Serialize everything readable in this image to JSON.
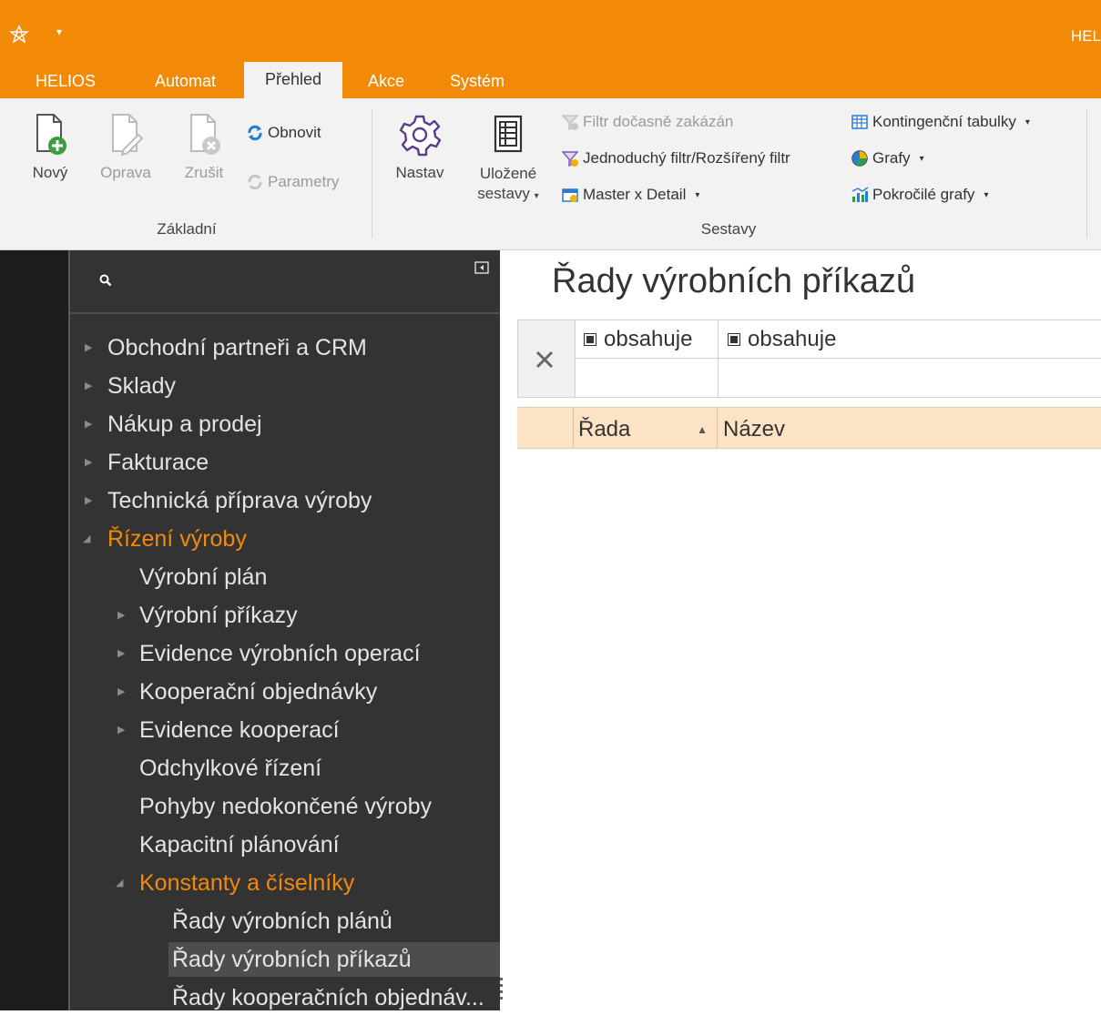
{
  "titlebar": {
    "app_title": "HEL",
    "logo_icon": "helios-logo-icon",
    "quick_access_icon": "dropdown-arrow-icon"
  },
  "tabs": [
    {
      "label": "HELIOS"
    },
    {
      "label": "Automat"
    },
    {
      "label": "Přehled",
      "active": true
    },
    {
      "label": "Akce"
    },
    {
      "label": "Systém"
    }
  ],
  "ribbon": {
    "groups": {
      "zakladni": "Základní",
      "sestavy": "Sestavy"
    },
    "buttons": {
      "novy": "Nový",
      "oprava": "Oprava",
      "zrusit": "Zrušit",
      "obnovit": "Obnovit",
      "parametry": "Parametry",
      "nastav": "Nastav",
      "ulozene_1": "Uložené",
      "ulozene_2": "sestavy",
      "filtr_docasne": "Filtr dočasně zakázán",
      "jednoduchy_filtr": "Jednoduchý filtr/Rozšířený filtr",
      "master_detail": "Master x Detail",
      "kontingencni": "Kontingenční tabulky",
      "grafy": "Grafy",
      "pokrocile_grafy": "Pokročilé grafy"
    },
    "colors": {
      "accent": "#f28a08"
    }
  },
  "nav": {
    "items": [
      {
        "label": "Obchodní partneři a CRM"
      },
      {
        "label": "Sklady"
      },
      {
        "label": "Nákup a prodej"
      },
      {
        "label": "Fakturace"
      },
      {
        "label": "Technická příprava výroby"
      },
      {
        "label": "Řízení výroby",
        "expanded": true,
        "highlight": true
      },
      {
        "label": "Výrobní plán"
      },
      {
        "label": "Výrobní příkazy"
      },
      {
        "label": "Evidence výrobních operací"
      },
      {
        "label": "Kooperační objednávky"
      },
      {
        "label": "Evidence kooperací"
      },
      {
        "label": "Odchylkové řízení"
      },
      {
        "label": "Pohyby nedokončené výroby"
      },
      {
        "label": "Kapacitní plánování"
      },
      {
        "label": "Konstanty a číselníky",
        "expanded": true,
        "highlight": true
      },
      {
        "label": "Řady výrobních plánů"
      },
      {
        "label": "Řady výrobních příkazů",
        "selected": true
      },
      {
        "label": "Řady kooperačních objednáv..."
      }
    ]
  },
  "main": {
    "title": "Řady výrobních příkazů",
    "filter": {
      "col1_operator": "obsahuje",
      "col2_operator": "obsahuje",
      "col1_value": "",
      "col2_value": ""
    },
    "grid": {
      "columns": [
        "Řada",
        "Název"
      ],
      "sorted_column": "Řada",
      "sort_direction": "ascending",
      "rows": []
    }
  }
}
